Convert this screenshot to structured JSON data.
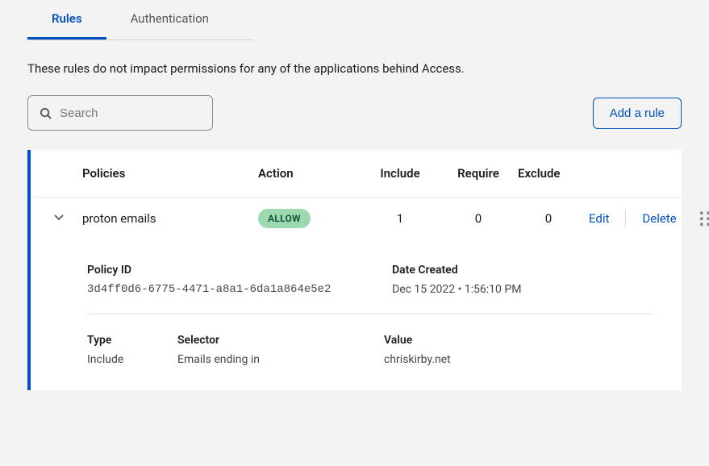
{
  "tabs": {
    "rules": "Rules",
    "authentication": "Authentication"
  },
  "description": "These rules do not impact permissions for any of the applications behind Access.",
  "search": {
    "placeholder": "Search"
  },
  "buttons": {
    "add_rule": "Add a rule"
  },
  "table": {
    "headers": {
      "policies": "Policies",
      "action": "Action",
      "include": "Include",
      "require": "Require",
      "exclude": "Exclude"
    },
    "row": {
      "name": "proton emails",
      "action_badge": "ALLOW",
      "include": "1",
      "require": "0",
      "exclude": "0",
      "edit": "Edit",
      "delete": "Delete"
    }
  },
  "details": {
    "policy_id_label": "Policy ID",
    "policy_id_value": "3d4ff0d6-6775-4471-a8a1-6da1a864e5e2",
    "date_created_label": "Date Created",
    "date_created_value": "Dec 15 2022 • 1:56:10 PM",
    "type_label": "Type",
    "type_value": "Include",
    "selector_label": "Selector",
    "selector_value": "Emails ending in",
    "value_label": "Value",
    "value_value": "chriskirby.net"
  }
}
